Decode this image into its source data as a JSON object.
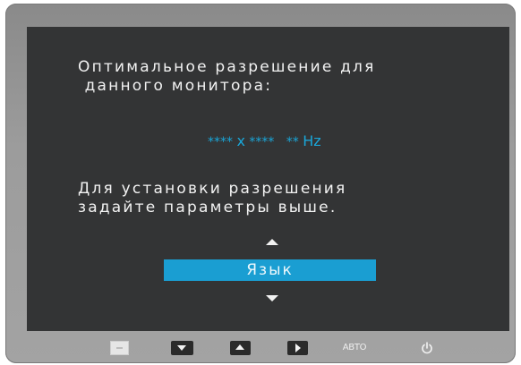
{
  "osd": {
    "line1": "Оптимальное разрешение для",
    "line2": " данного монитора:",
    "resolution_width": "****",
    "resolution_x": "x",
    "resolution_height": "****",
    "refresh_rate": "**",
    "refresh_unit": "Hz",
    "instruction_line1": "Для установки разрешения",
    "instruction_line2": "задайте параметры выше.",
    "selected_option": "Язык"
  },
  "buttons": {
    "auto_label": "АВТО"
  },
  "colors": {
    "accent": "#1a9ed2",
    "resolution_text": "#1aa6d8",
    "screen_background": "#333435",
    "bezel": "#9a9a9a"
  },
  "icons": {
    "menu": "menu-icon",
    "down": "down-arrow-icon",
    "up": "up-arrow-icon",
    "enter": "enter-icon",
    "power": "power-icon"
  }
}
